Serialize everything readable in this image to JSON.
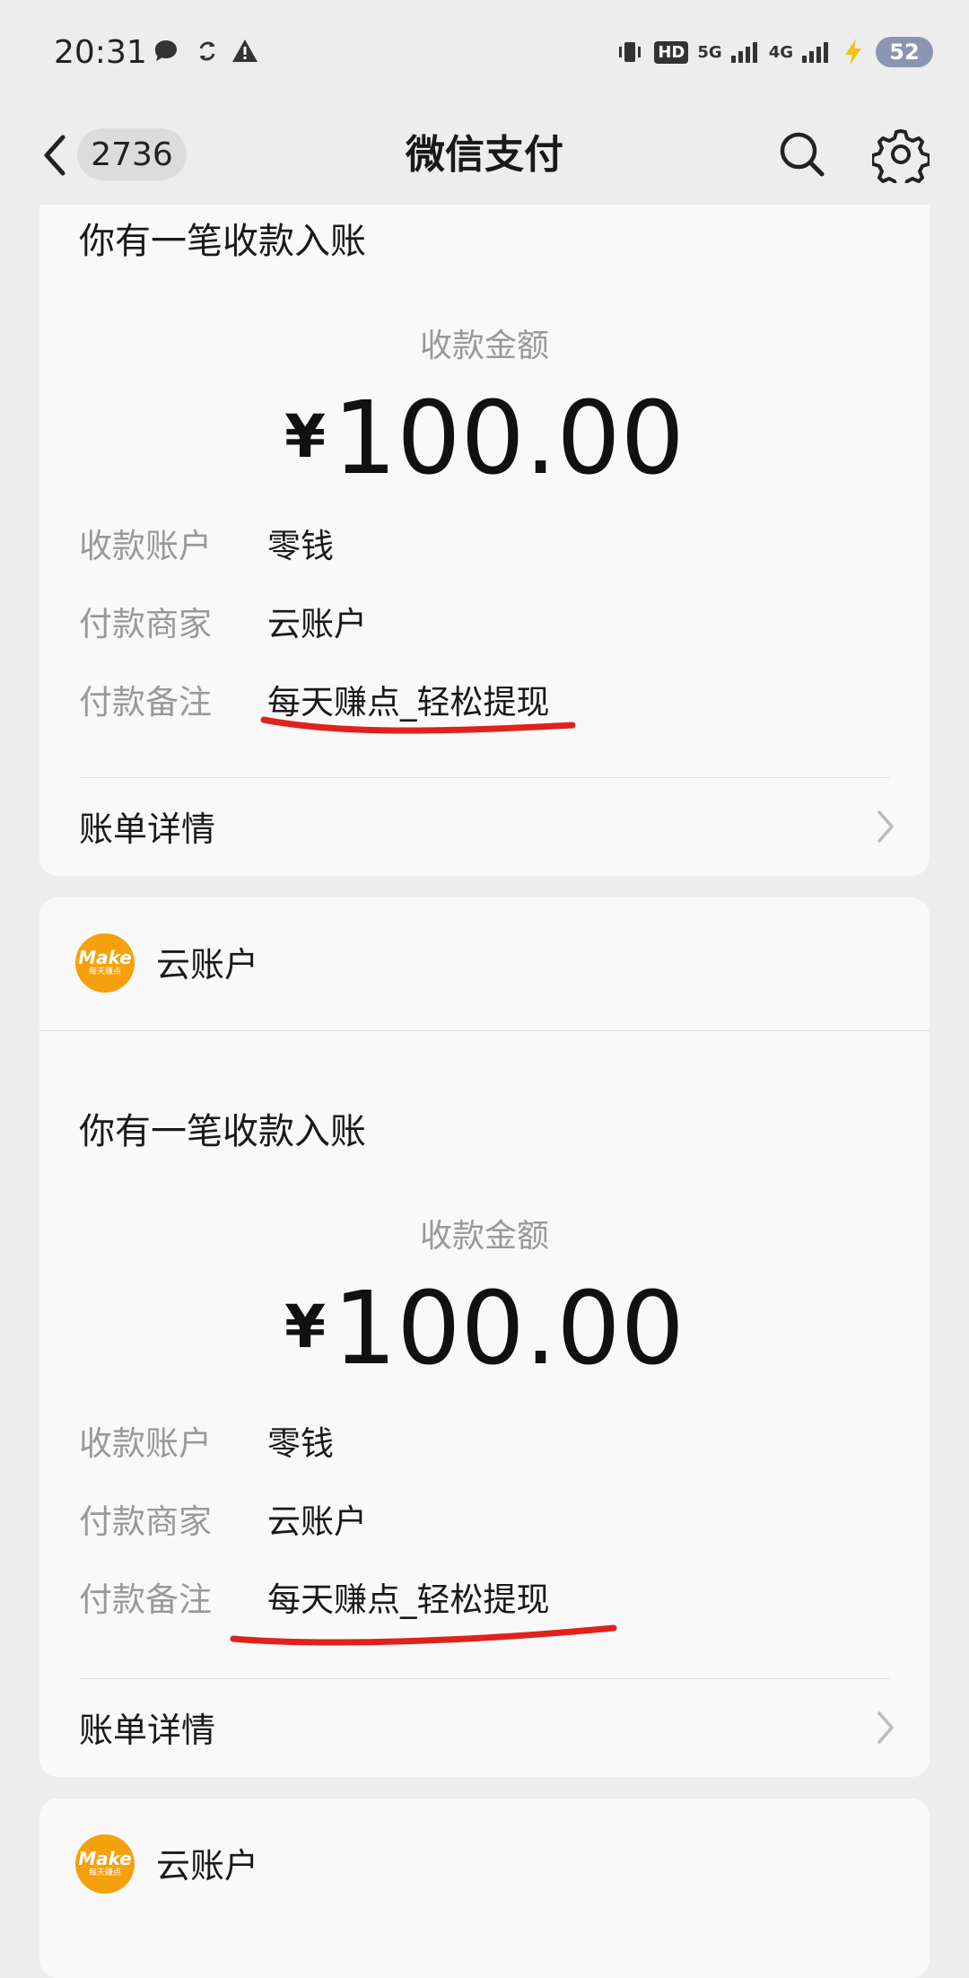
{
  "status_bar": {
    "time": "20:31",
    "hd_label": "HD",
    "net1": "5G",
    "net2": "4G",
    "battery": "52"
  },
  "nav": {
    "unread_count": "2736",
    "title": "微信支付"
  },
  "cards": [
    {
      "merchant": "",
      "title": "你有一笔收款入账",
      "amount_label": "收款金额",
      "currency": "¥",
      "amount": "100.00",
      "rows": [
        {
          "label": "收款账户",
          "value": "零钱"
        },
        {
          "label": "付款商家",
          "value": "云账户"
        },
        {
          "label": "付款备注",
          "value": "每天赚点_轻松提现"
        }
      ],
      "detail_label": "账单详情"
    },
    {
      "merchant": "云账户",
      "logo_text": "Make",
      "logo_sub": "每天赚点",
      "title": "你有一笔收款入账",
      "amount_label": "收款金额",
      "currency": "¥",
      "amount": "100.00",
      "rows": [
        {
          "label": "收款账户",
          "value": "零钱"
        },
        {
          "label": "付款商家",
          "value": "云账户"
        },
        {
          "label": "付款备注",
          "value": "每天赚点_轻松提现"
        }
      ],
      "detail_label": "账单详情"
    },
    {
      "merchant": "云账户",
      "logo_text": "Make",
      "logo_sub": "每天赚点"
    }
  ],
  "colors": {
    "background": "#ededed",
    "card": "#f9f9f9",
    "annotation": "#e0221c",
    "logo": "#f5a10e"
  }
}
